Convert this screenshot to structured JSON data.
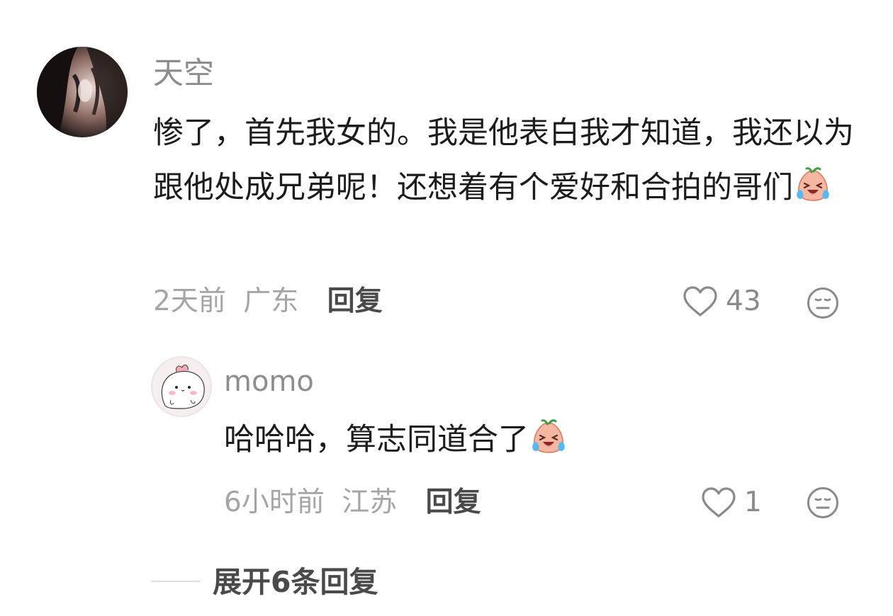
{
  "colors": {
    "username": "#8d8d8d",
    "text": "#1c1c1c",
    "meta": "#a5a5a5",
    "reply_label": "#4a4a4a"
  },
  "comment": {
    "username": "天空",
    "text": "惨了，首先我女的。我是他表白我才知道，我还以为跟他处成兄弟呢！还想着有个爱好和合拍的哥们",
    "emoji": "crying-laughing-emoji",
    "time": "2天前",
    "location": "广东",
    "reply_label": "回复",
    "likes": "43"
  },
  "reply": {
    "username": "momo",
    "text": "哈哈哈，算志同道合了",
    "emoji": "crying-laughing-emoji",
    "time": "6小时前",
    "location": "江苏",
    "reply_label": "回复",
    "likes": "1"
  },
  "expand_label": "展开6条回复"
}
